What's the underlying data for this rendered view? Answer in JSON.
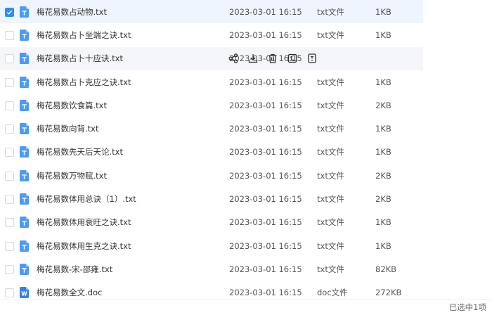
{
  "files": [
    {
      "name": "梅花易数占动物.txt",
      "date": "2023-03-01 16:15",
      "type": "txt文件",
      "size": "1KB",
      "icon": "txt-file-icon",
      "checked": true
    },
    {
      "name": "梅花易数占卜坐端之诀.txt",
      "date": "2023-03-01 16:15",
      "type": "txt文件",
      "size": "1KB",
      "icon": "txt-file-icon",
      "checked": false
    },
    {
      "name": "梅花易数占卜十应诀.txt",
      "date": "2023-03-01 16:15",
      "type": "",
      "size": "",
      "icon": "txt-file-icon",
      "checked": false
    },
    {
      "name": "梅花易数占卜克应之诀.txt",
      "date": "2023-03-01 16:15",
      "type": "txt文件",
      "size": "1KB",
      "icon": "txt-file-icon",
      "checked": false
    },
    {
      "name": "梅花易数饮食篇.txt",
      "date": "2023-03-01 16:15",
      "type": "txt文件",
      "size": "2KB",
      "icon": "txt-file-icon",
      "checked": false
    },
    {
      "name": "梅花易数向背.txt",
      "date": "2023-03-01 16:15",
      "type": "txt文件",
      "size": "1KB",
      "icon": "txt-file-icon",
      "checked": false
    },
    {
      "name": "梅花易数先天后天论.txt",
      "date": "2023-03-01 16:15",
      "type": "txt文件",
      "size": "1KB",
      "icon": "txt-file-icon",
      "checked": false
    },
    {
      "name": "梅花易数万物赋.txt",
      "date": "2023-03-01 16:15",
      "type": "txt文件",
      "size": "2KB",
      "icon": "txt-file-icon",
      "checked": false
    },
    {
      "name": "梅花易数体用总诀（1）.txt",
      "date": "2023-03-01 16:15",
      "type": "txt文件",
      "size": "2KB",
      "icon": "txt-file-icon",
      "checked": false
    },
    {
      "name": "梅花易数体用衰旺之诀.txt",
      "date": "2023-03-01 16:15",
      "type": "txt文件",
      "size": "1KB",
      "icon": "txt-file-icon",
      "checked": false
    },
    {
      "name": "梅花易数体用生克之诀.txt",
      "date": "2023-03-01 16:15",
      "type": "txt文件",
      "size": "1KB",
      "icon": "txt-file-icon",
      "checked": false
    },
    {
      "name": "梅花易数-宋-邵雍.txt",
      "date": "2023-03-01 16:15",
      "type": "txt文件",
      "size": "82KB",
      "icon": "txt-file-icon",
      "checked": false
    },
    {
      "name": "梅花易数全文.doc",
      "date": "2023-03-01 16:15",
      "type": "doc文件",
      "size": "272KB",
      "icon": "doc-file-icon",
      "checked": false
    }
  ],
  "hovered_row_index": 2,
  "row_actions": [
    {
      "name": "share-icon"
    },
    {
      "name": "download-icon"
    },
    {
      "name": "delete-icon"
    },
    {
      "name": "rename-icon"
    },
    {
      "name": "more-icon"
    }
  ],
  "status": {
    "selected_text": "已选中1项"
  },
  "colors": {
    "accent": "#2f8cf5",
    "selected_row_bg": "#eef5ff",
    "hover_row_bg": "#f4f6f9",
    "file_icon": "#4b9af7",
    "doc_icon": "#3a7ee9"
  }
}
